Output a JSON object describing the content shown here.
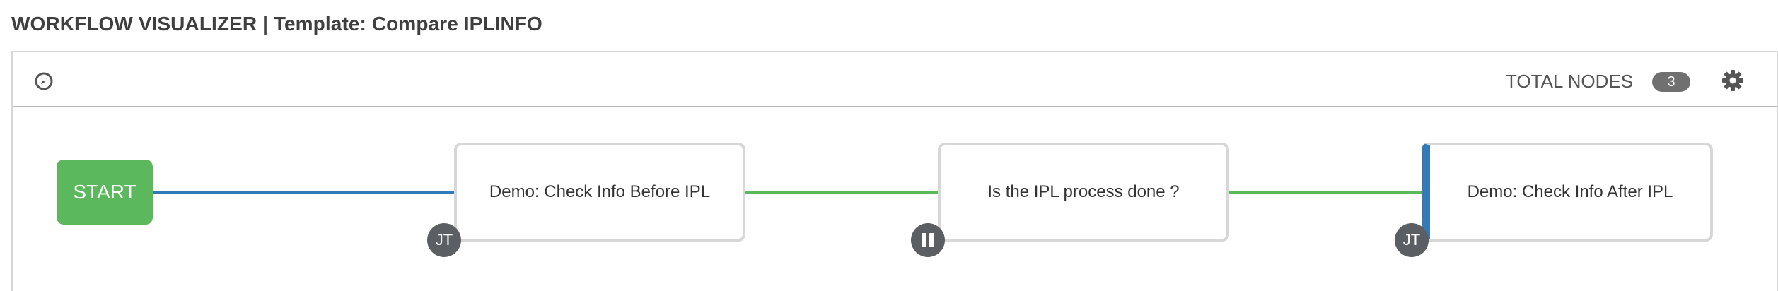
{
  "header": {
    "title": "WORKFLOW VISUALIZER | Template: Compare IPLINFO"
  },
  "toolbar": {
    "compass_icon": "compass-icon",
    "total_nodes_label": "TOTAL NODES",
    "total_nodes_count": "3",
    "settings_icon": "gear-icon"
  },
  "workflow": {
    "start_label": "START",
    "nodes": [
      {
        "label": "Demo: Check Info Before IPL",
        "badge": "JT",
        "type": "job-template"
      },
      {
        "label": "Is the IPL process done ?",
        "badge": "pause-icon",
        "type": "approval"
      },
      {
        "label": "Demo: Check Info After IPL",
        "badge": "JT",
        "type": "job-template"
      }
    ],
    "colors": {
      "start": "#5cb85c",
      "link_always": "#337ab7",
      "link_success": "#5cb85c",
      "node_border": "#d7d7d7",
      "active_edge": "#337ab7",
      "badge": "#5b5f63"
    }
  }
}
